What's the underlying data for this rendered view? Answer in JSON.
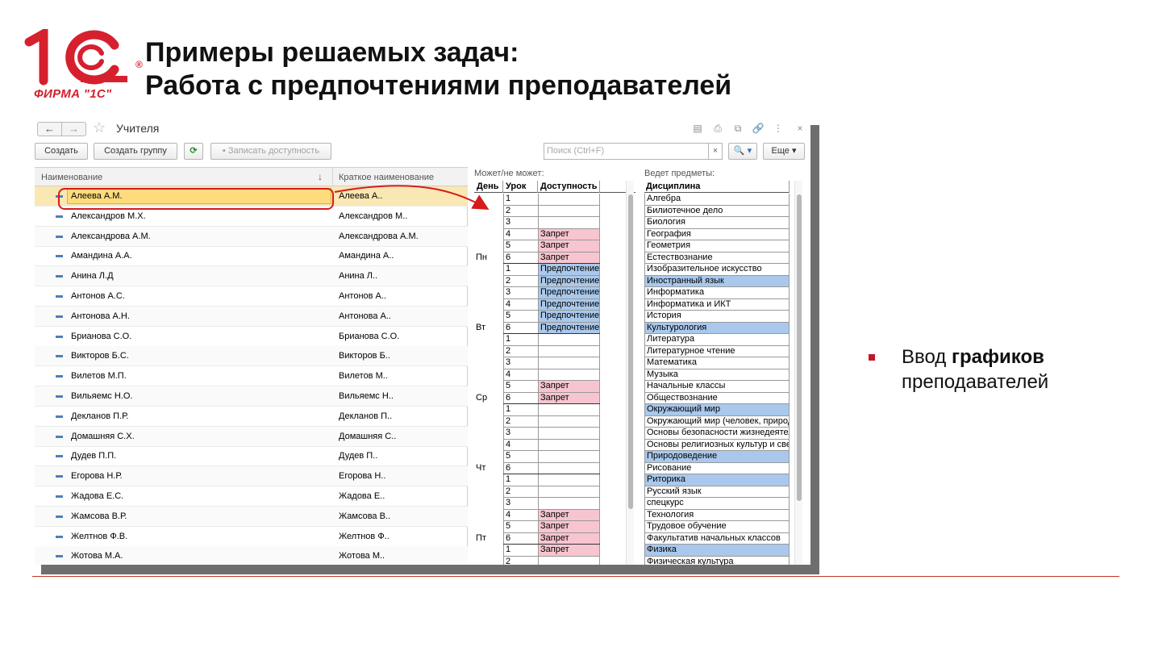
{
  "slide": {
    "logo_text": "ФИРМА \"1С\"",
    "logo_reg": "®",
    "title_line1": "Примеры решаемых задач:",
    "title_line2": "Работа с предпочтениями преподавателей",
    "bullet_plain": "Ввод ",
    "bullet_bold": "графиков",
    "bullet_rest": "преподавателей"
  },
  "window": {
    "title": "Учителя",
    "nav_back": "←",
    "nav_fwd": "→",
    "toolbar": {
      "create": "Создать",
      "create_group": "Создать группу",
      "save_availability": "Записать доступность",
      "search_placeholder": "Поиск (Ctrl+F)",
      "search_clear": "×",
      "more": "Еще ▾",
      "search_btn": "🔍 ▾"
    },
    "list": {
      "col_name": "Наименование",
      "col_short": "Краткое наименование",
      "sort_icon": "↓",
      "rows": [
        {
          "name": "Алеева А.М.",
          "short": "Алеева А.."
        },
        {
          "name": "Александров М.Х.",
          "short": "Александров М.."
        },
        {
          "name": "Александрова А.М.",
          "short": "Александрова А.М."
        },
        {
          "name": "Амандина А.А.",
          "short": "Амандина А.."
        },
        {
          "name": "Анина Л.Д",
          "short": "Анина Л.."
        },
        {
          "name": "Антонов А.С.",
          "short": "Антонов А.."
        },
        {
          "name": "Антонова А.Н.",
          "short": "Антонова А.."
        },
        {
          "name": "Брианова С.О.",
          "short": "Брианова С.О."
        },
        {
          "name": "Викторов Б.С.",
          "short": "Викторов Б.."
        },
        {
          "name": "Вилетов М.П.",
          "short": "Вилетов М.."
        },
        {
          "name": "Вильяемс Н.О.",
          "short": "Вильяемс Н.."
        },
        {
          "name": "Декланов П.Р.",
          "short": "Декланов П.."
        },
        {
          "name": "Домашняя С.Х.",
          "short": "Домашняя С.."
        },
        {
          "name": "Дудев П.П.",
          "short": "Дудев П.."
        },
        {
          "name": "Егорова Н.Р.",
          "short": "Егорова Н.."
        },
        {
          "name": "Жадова Е.С.",
          "short": "Жадова Е.."
        },
        {
          "name": "Жамсова В.Р.",
          "short": "Жамсова В.."
        },
        {
          "name": "Желтнов Ф.В.",
          "short": "Желтнов Ф.."
        },
        {
          "name": "Жотова М.А.",
          "short": "Жотова М.."
        }
      ]
    },
    "schedule": {
      "label": "Может/не может:",
      "col_day": "День",
      "col_lesson": "Урок",
      "col_avail": "Доступность",
      "rows": [
        {
          "day": "",
          "n": "1",
          "v": "",
          "t": ""
        },
        {
          "day": "",
          "n": "2",
          "v": "",
          "t": ""
        },
        {
          "day": "",
          "n": "3",
          "v": "",
          "t": ""
        },
        {
          "day": "",
          "n": "4",
          "v": "Запрет",
          "t": "ban"
        },
        {
          "day": "",
          "n": "5",
          "v": "Запрет",
          "t": "ban"
        },
        {
          "day": "Пн",
          "n": "6",
          "v": "Запрет",
          "t": "ban"
        },
        {
          "day": "",
          "n": "1",
          "v": "Предпочтение",
          "t": "pref"
        },
        {
          "day": "",
          "n": "2",
          "v": "Предпочтение",
          "t": "pref"
        },
        {
          "day": "",
          "n": "3",
          "v": "Предпочтение",
          "t": "pref"
        },
        {
          "day": "",
          "n": "4",
          "v": "Предпочтение",
          "t": "pref"
        },
        {
          "day": "",
          "n": "5",
          "v": "Предпочтение",
          "t": "pref"
        },
        {
          "day": "Вт",
          "n": "6",
          "v": "Предпочтение",
          "t": "pref"
        },
        {
          "day": "",
          "n": "1",
          "v": "",
          "t": ""
        },
        {
          "day": "",
          "n": "2",
          "v": "",
          "t": ""
        },
        {
          "day": "",
          "n": "3",
          "v": "",
          "t": ""
        },
        {
          "day": "",
          "n": "4",
          "v": "",
          "t": ""
        },
        {
          "day": "",
          "n": "5",
          "v": "Запрет",
          "t": "ban"
        },
        {
          "day": "Ср",
          "n": "6",
          "v": "Запрет",
          "t": "ban"
        },
        {
          "day": "",
          "n": "1",
          "v": "",
          "t": ""
        },
        {
          "day": "",
          "n": "2",
          "v": "",
          "t": ""
        },
        {
          "day": "",
          "n": "3",
          "v": "",
          "t": ""
        },
        {
          "day": "",
          "n": "4",
          "v": "",
          "t": ""
        },
        {
          "day": "",
          "n": "5",
          "v": "",
          "t": ""
        },
        {
          "day": "Чт",
          "n": "6",
          "v": "",
          "t": ""
        },
        {
          "day": "",
          "n": "1",
          "v": "",
          "t": ""
        },
        {
          "day": "",
          "n": "2",
          "v": "",
          "t": ""
        },
        {
          "day": "",
          "n": "3",
          "v": "",
          "t": ""
        },
        {
          "day": "",
          "n": "4",
          "v": "Запрет",
          "t": "ban"
        },
        {
          "day": "",
          "n": "5",
          "v": "Запрет",
          "t": "ban"
        },
        {
          "day": "Пт",
          "n": "6",
          "v": "Запрет",
          "t": "ban"
        },
        {
          "day": "",
          "n": "1",
          "v": "Запрет",
          "t": "ban"
        },
        {
          "day": "",
          "n": "2",
          "v": "",
          "t": ""
        }
      ]
    },
    "subjects": {
      "label": "Ведет предметы:",
      "col": "Дисциплина",
      "rows": [
        {
          "name": "Алгебра",
          "sel": false
        },
        {
          "name": "Билиотечное дело",
          "sel": false
        },
        {
          "name": "Биология",
          "sel": false
        },
        {
          "name": "География",
          "sel": false
        },
        {
          "name": "Геометрия",
          "sel": false
        },
        {
          "name": "Естествознание",
          "sel": false
        },
        {
          "name": "Изобразительное искусство",
          "sel": false
        },
        {
          "name": "Иностранный язык",
          "sel": true
        },
        {
          "name": "Информатика",
          "sel": false
        },
        {
          "name": "Информатика и ИКТ",
          "sel": false
        },
        {
          "name": "История",
          "sel": false
        },
        {
          "name": "Культурология",
          "sel": true
        },
        {
          "name": "Литература",
          "sel": false
        },
        {
          "name": "Литературное чтение",
          "sel": false
        },
        {
          "name": "Математика",
          "sel": false
        },
        {
          "name": "Музыка",
          "sel": false
        },
        {
          "name": "Начальные классы",
          "sel": false
        },
        {
          "name": "Обществознание",
          "sel": false
        },
        {
          "name": "Окружающий мир",
          "sel": true
        },
        {
          "name": "Окружающий мир (человек, природа",
          "sel": false
        },
        {
          "name": "Основы безопасности жизнедеятельности",
          "sel": false
        },
        {
          "name": "Основы религиозных культур и светской этики",
          "sel": false
        },
        {
          "name": "Природоведение",
          "sel": true
        },
        {
          "name": "Рисование",
          "sel": false
        },
        {
          "name": "Риторика",
          "sel": true
        },
        {
          "name": "Русский язык",
          "sel": false
        },
        {
          "name": "спецкурс",
          "sel": false
        },
        {
          "name": "Технология",
          "sel": false
        },
        {
          "name": "Трудовое обучение",
          "sel": false
        },
        {
          "name": "Факультатив начальных классов",
          "sel": false
        },
        {
          "name": "Физика",
          "sel": true
        },
        {
          "name": "Физическая культура",
          "sel": false
        }
      ]
    }
  },
  "colors": {
    "brand_red": "#d6202e",
    "ban": "#f7c5cf",
    "preference": "#a9c8ec",
    "selected_row": "#fcdc7c"
  }
}
